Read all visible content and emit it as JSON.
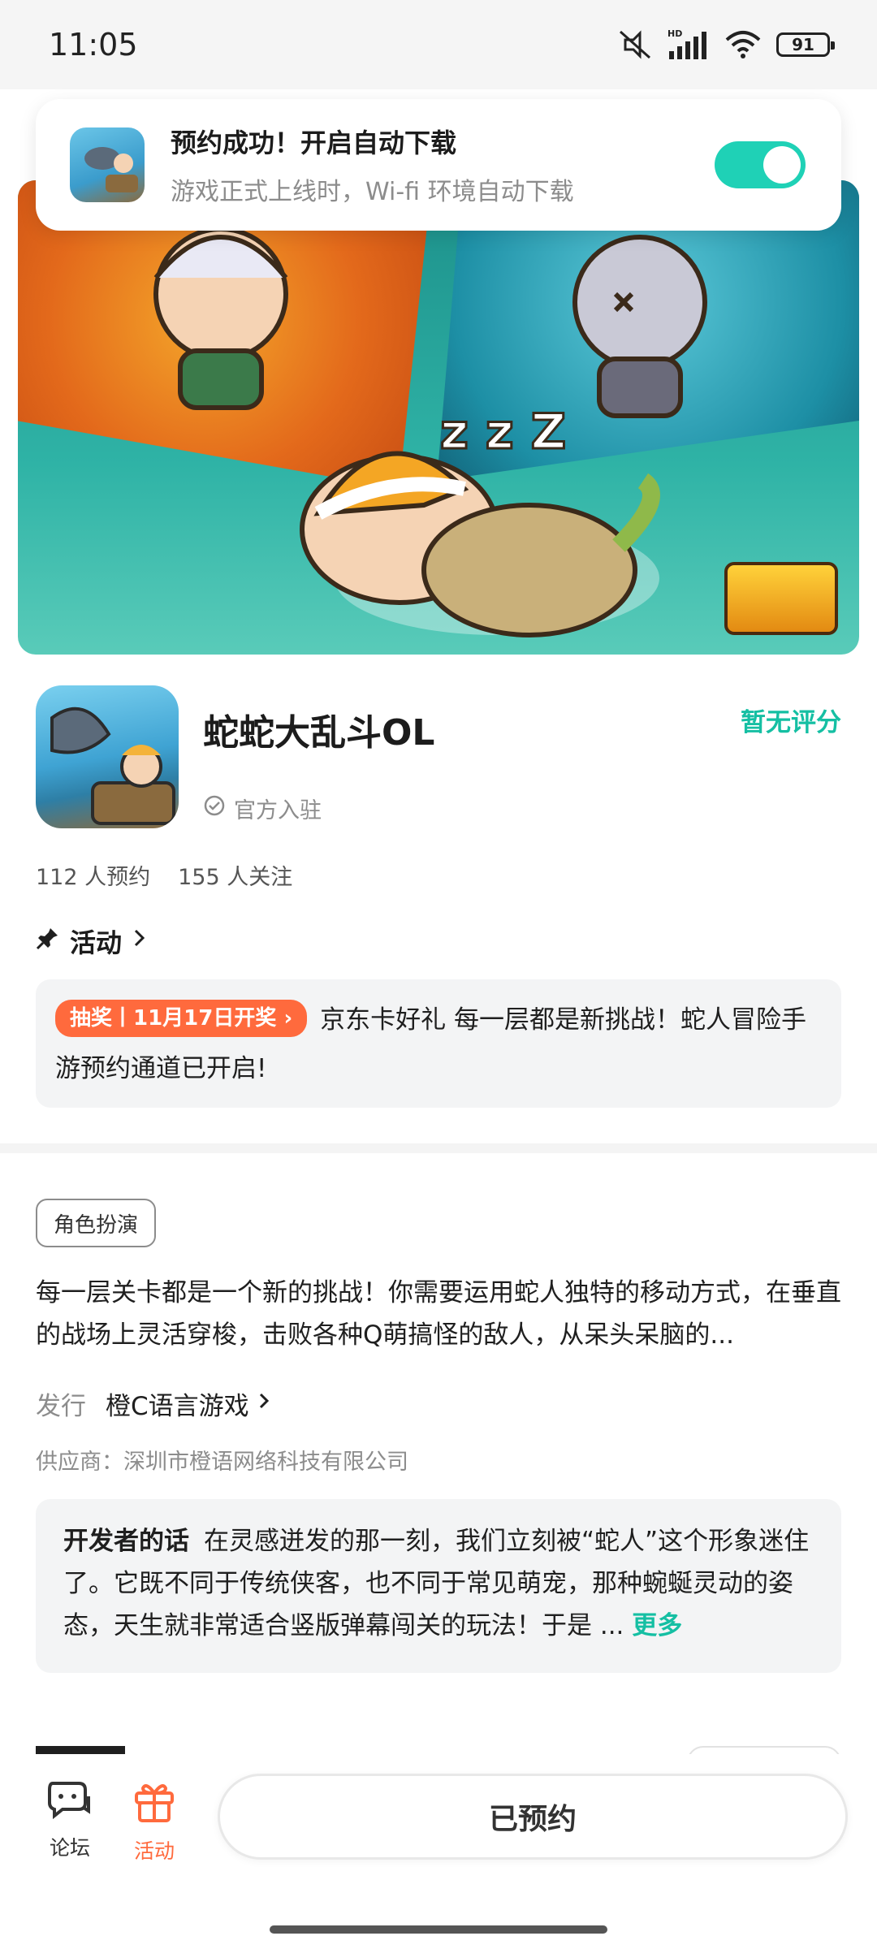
{
  "status_bar": {
    "time": "11:05",
    "battery": "91",
    "network": "HD"
  },
  "toast": {
    "title": "预约成功！开启自动下载",
    "subtitle": "游戏正式上线时，Wi-fi 环境自动下载",
    "toggle_on": true
  },
  "game": {
    "title": "蛇蛇大乱斗OL",
    "official": "官方入驻",
    "rating": "暂无评分",
    "reservations": "112 人预约",
    "followers": "155 人关注"
  },
  "activity": {
    "section_title": "活动",
    "tag": "抽奖丨11月17日开奖",
    "text": "京东卡好礼 每一层都是新挑战！蛇人冒险手游预约通道已开启!"
  },
  "details": {
    "genre": "角色扮演",
    "description": "每一层关卡都是一个新的挑战！你需要运用蛇人独特的移动方式，在垂直的战场上灵活穿梭，击败各种Q萌搞怪的敌人，从呆头呆脑的...",
    "publisher_label": "发行",
    "publisher": "橙C语言游戏",
    "supplier": "供应商：深圳市橙语网络科技有限公司",
    "developer_heading": "开发者的话",
    "developer_text": "在灵感迸发的那一刻，我们立刻被“蛇人”这个形象迷住了。它既不同于传统侠客，也不同于常见萌宠，那种蜿蜒灵动的姿态，天生就非常适合竖版弹幕闯关的玩法！于是 ...",
    "more": "更多"
  },
  "bottom_nav": {
    "forum": "论坛",
    "activity": "活动",
    "reserve_button": "已预约"
  },
  "colors": {
    "accent": "#15bfa3",
    "toggle": "#1fd1b6",
    "tag": "#ff6a3d"
  }
}
